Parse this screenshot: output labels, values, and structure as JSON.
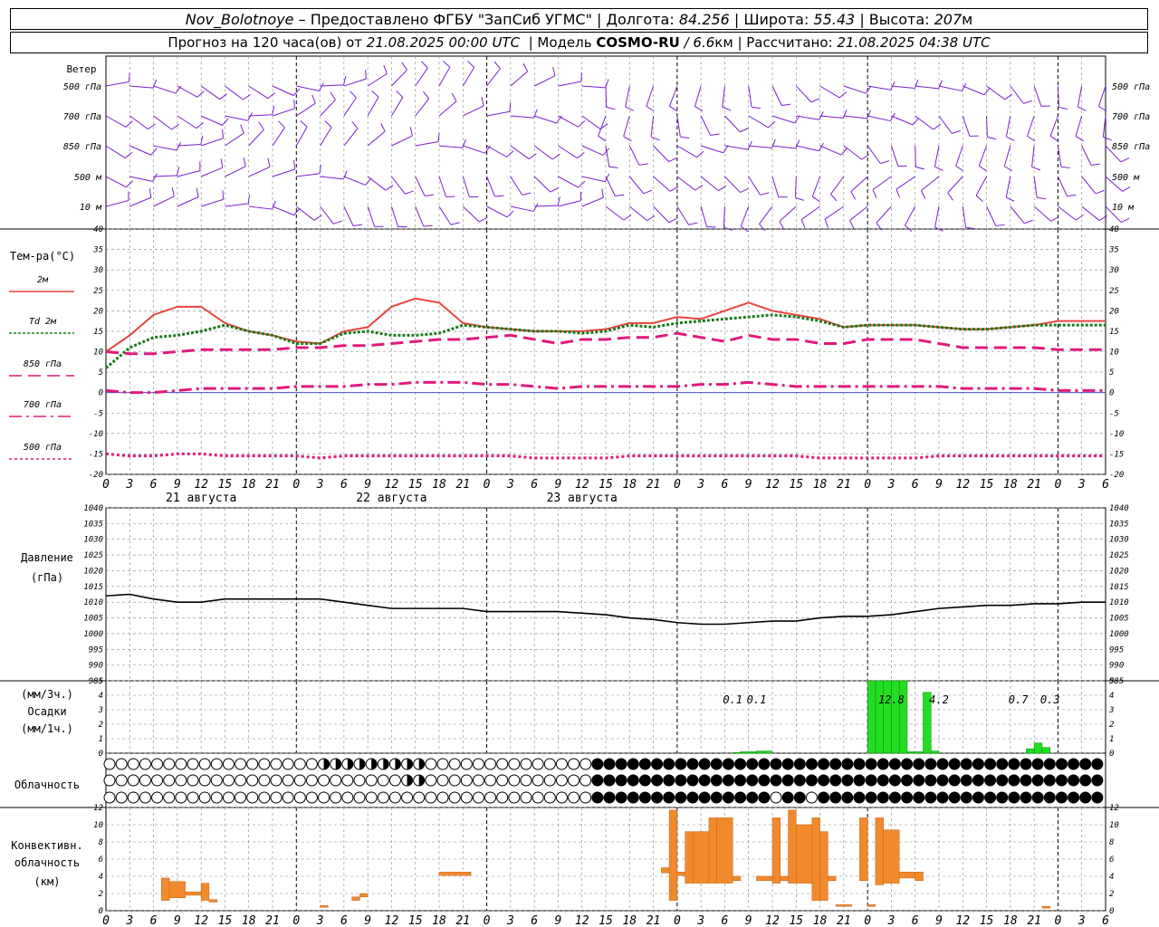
{
  "header": {
    "station": "Nov_Bolotnoye",
    "dash": " – ",
    "provider": "Предоставлено ФГБУ \"ЗапСиб УГМС\"",
    "sep": " | ",
    "lon_label": "Долгота: ",
    "lon_value": "84.256",
    "lat_label": "Широта: ",
    "lat_value": "55.43",
    "alt_label": "Высота: ",
    "alt_value": "207",
    "alt_unit": "м",
    "forecast_prefix": "Прогноз на 120 часа(ов) от ",
    "forecast_time": "21.08.2025 00:00 UTC",
    "model_label": "  | Модель ",
    "model_name": "COSMO-RU",
    "model_res": " / 6.6",
    "model_unit": "км",
    "calc_label": " | Рассчитано: ",
    "calc_time": "21.08.2025 04:38 UTC"
  },
  "colors": {
    "t2m": "#e8453c",
    "td2m": "#1a7a1a",
    "t850": "#e0197d",
    "t700": "#e0197d",
    "t500": "#e0197d",
    "wind": "#7a1fd0",
    "pressure": "#000000",
    "precip": "#22dd22",
    "conv": "#f08a2c",
    "grid": "#888888",
    "zero_line": "#3333cc"
  },
  "wind_panel": {
    "title": "Ветер",
    "levels": [
      "500 гПа",
      "700 гПа",
      "850 гПа",
      "500  м",
      "10   м"
    ],
    "right_levels": [
      "500 гПа",
      "700 гПа",
      "850 гПа",
      "500  м",
      "10   м"
    ]
  },
  "temp_panel": {
    "title": "Тем-ра(°C)",
    "legend": [
      {
        "label": "2м",
        "series": "t2m"
      },
      {
        "label": "Td  2м",
        "series": "td2m"
      },
      {
        "label": "850 гПа",
        "series": "t850"
      },
      {
        "label": "700 гПа",
        "series": "t700"
      },
      {
        "label": "500 гПа",
        "series": "t500"
      }
    ]
  },
  "pressure_panel": {
    "title": "Давление",
    "unit": "(гПа)"
  },
  "precip_panel": {
    "unit1": "(мм/3ч.)",
    "title": "Осадки",
    "unit2": "(мм/1ч.)"
  },
  "cloud_panel": {
    "title": "Облачность"
  },
  "conv_panel": {
    "title1": "Конвективн.",
    "title2": "облачность",
    "unit": "(км)"
  },
  "x_axis": {
    "hour_labels": [
      "0",
      "3",
      "6",
      "9",
      "12",
      "15",
      "18",
      "21",
      "0",
      "3",
      "6",
      "9",
      "12",
      "15",
      "18",
      "21",
      "0",
      "3",
      "6",
      "9",
      "12",
      "15",
      "18",
      "21",
      "0",
      "3",
      "6"
    ],
    "date_labels": [
      "21 августа",
      "22 августа",
      "23 августа"
    ]
  },
  "chart_data": [
    {
      "type": "line",
      "title": "Тем-ра(°C)",
      "x_hours": [
        0,
        3,
        6,
        9,
        12,
        15,
        18,
        21,
        24,
        27,
        30,
        33,
        36,
        39,
        42,
        45,
        48,
        51,
        54,
        57,
        60,
        63,
        66,
        69,
        72,
        75,
        78,
        81,
        84,
        87,
        90,
        93,
        96,
        99,
        102,
        105,
        108,
        111,
        114,
        117,
        120,
        123,
        126
      ],
      "ylim": [
        -20,
        40
      ],
      "yticks": [
        -20,
        -15,
        -10,
        -5,
        0,
        5,
        10,
        15,
        20,
        25,
        30,
        35,
        40
      ],
      "series": [
        {
          "name": "2м",
          "values": [
            10,
            14,
            19,
            21,
            21,
            17,
            15,
            14,
            12.5,
            12,
            15,
            16,
            21,
            23,
            22,
            17,
            16,
            15.5,
            15,
            15,
            15,
            15.5,
            17,
            17,
            18.5,
            18,
            20,
            22,
            20,
            19,
            18,
            16,
            16.5,
            16.5,
            16.5,
            16,
            15.5,
            15.5,
            16,
            16.5,
            17.5,
            17.5,
            17.5
          ]
        },
        {
          "name": "Td 2м",
          "values": [
            6,
            11,
            13.5,
            14,
            15,
            16.5,
            15,
            14,
            12,
            12,
            14.5,
            15,
            14,
            14,
            14.5,
            16.5,
            16,
            15.5,
            15,
            15,
            14.5,
            15,
            16.5,
            16,
            17,
            17.5,
            18,
            18.5,
            19,
            18.5,
            17.5,
            16,
            16.5,
            16.5,
            16.5,
            16,
            15.5,
            15.5,
            16,
            16.5,
            16.5,
            16.5,
            16.5
          ]
        },
        {
          "name": "850 гПа",
          "values": [
            10,
            9.5,
            9.5,
            10,
            10.5,
            10.5,
            10.5,
            10.5,
            11,
            11,
            11.5,
            11.5,
            12,
            12.5,
            13,
            13,
            13.5,
            14,
            13,
            12,
            13,
            13,
            13.5,
            13.5,
            14.5,
            13.5,
            12.5,
            14,
            13,
            13,
            12,
            12,
            13,
            13,
            13,
            12,
            11,
            11,
            11,
            11,
            10.5,
            10.5,
            10.5
          ]
        },
        {
          "name": "700 гПа",
          "values": [
            0.5,
            0,
            0,
            0.5,
            1,
            1,
            1,
            1,
            1.5,
            1.5,
            1.5,
            2,
            2,
            2.5,
            2.5,
            2.5,
            2,
            2,
            1.5,
            1,
            1.5,
            1.5,
            1.5,
            1.5,
            1.5,
            2,
            2,
            2.5,
            2,
            1.5,
            1.5,
            1.5,
            1.5,
            1.5,
            1.5,
            1.5,
            1,
            1,
            1,
            1,
            0.5,
            0.5,
            0.5
          ]
        },
        {
          "name": "500 гПа",
          "values": [
            -15,
            -15.5,
            -15.5,
            -15,
            -15,
            -15.5,
            -15.5,
            -15.5,
            -15.5,
            -16,
            -15.5,
            -15.5,
            -15.5,
            -15.5,
            -15.5,
            -15.5,
            -15.5,
            -15.5,
            -16,
            -16,
            -16,
            -16,
            -15.5,
            -15.5,
            -15.5,
            -15.5,
            -15.5,
            -15.5,
            -15.5,
            -15.5,
            -16,
            -16,
            -16,
            -16,
            -16,
            -15.5,
            -15.5,
            -15.5,
            -15.5,
            -15.5,
            -15.5,
            -15.5,
            -15.5
          ]
        }
      ]
    },
    {
      "type": "line",
      "title": "Давление (гПа)",
      "x_hours": [
        0,
        3,
        6,
        9,
        12,
        15,
        18,
        21,
        24,
        27,
        30,
        33,
        36,
        39,
        42,
        45,
        48,
        51,
        54,
        57,
        60,
        63,
        66,
        69,
        72,
        75,
        78,
        81,
        84,
        87,
        90,
        93,
        96,
        99,
        102,
        105,
        108,
        111,
        114,
        117,
        120,
        123,
        126
      ],
      "ylim": [
        985,
        1040
      ],
      "yticks": [
        985,
        990,
        995,
        1000,
        1005,
        1010,
        1015,
        1020,
        1025,
        1030,
        1035,
        1040
      ],
      "series": [
        {
          "name": "Давление",
          "values": [
            1012,
            1012.5,
            1011,
            1010,
            1010,
            1011,
            1011,
            1011,
            1011,
            1011,
            1010,
            1009,
            1008,
            1008,
            1008,
            1008,
            1007,
            1007,
            1007,
            1007,
            1006.5,
            1006,
            1005,
            1004.5,
            1003.5,
            1003,
            1003,
            1003.5,
            1004,
            1004,
            1005,
            1005.5,
            1005.5,
            1006,
            1007,
            1008,
            1008.5,
            1009,
            1009,
            1009.5,
            1009.5,
            1010,
            1010
          ]
        }
      ]
    },
    {
      "type": "bar",
      "title": "Осадки",
      "ylim": [
        0,
        5
      ],
      "yticks": [
        0,
        1,
        2,
        3,
        4,
        5
      ],
      "bars": [
        {
          "hour": 79,
          "value": 0.05
        },
        {
          "hour": 80,
          "value": 0.1
        },
        {
          "hour": 81,
          "value": 0.1
        },
        {
          "hour": 82,
          "value": 0.15
        },
        {
          "hour": 83,
          "value": 0.15
        },
        {
          "hour": 96,
          "value": 6.0
        },
        {
          "hour": 97,
          "value": 6.0
        },
        {
          "hour": 98,
          "value": 6.0
        },
        {
          "hour": 99,
          "value": 6.0
        },
        {
          "hour": 100,
          "value": 6.0
        },
        {
          "hour": 101,
          "value": 0.1
        },
        {
          "hour": 102,
          "value": 0.1
        },
        {
          "hour": 103,
          "value": 4.2
        },
        {
          "hour": 104,
          "value": 0.15
        },
        {
          "hour": 116,
          "value": 0.3
        },
        {
          "hour": 117,
          "value": 0.7
        },
        {
          "hour": 118,
          "value": 0.4
        }
      ],
      "labels": [
        {
          "hour": 79,
          "text": "0.1"
        },
        {
          "hour": 82,
          "text": "0.1"
        },
        {
          "hour": 99,
          "text": "12.8"
        },
        {
          "hour": 105,
          "text": "4.2"
        },
        {
          "hour": 115,
          "text": "0.7"
        },
        {
          "hour": 119,
          "text": "0.3"
        }
      ]
    },
    {
      "type": "bar",
      "title": "Конвективн. облачность (км)",
      "ylim": [
        0,
        12
      ],
      "yticks": [
        0,
        2,
        4,
        6,
        8,
        10,
        12
      ],
      "bars": [
        {
          "from": 7,
          "to": 8,
          "bottom": 1.2,
          "top": 3.8
        },
        {
          "from": 8,
          "to": 10,
          "bottom": 1.5,
          "top": 3.4
        },
        {
          "from": 10,
          "to": 12,
          "bottom": 1.8,
          "top": 2.2
        },
        {
          "from": 12,
          "to": 13,
          "bottom": 1.2,
          "top": 3.2
        },
        {
          "from": 13,
          "to": 14,
          "bottom": 1.0,
          "top": 1.3
        },
        {
          "from": 27,
          "to": 28,
          "bottom": 0.4,
          "top": 0.6
        },
        {
          "from": 31,
          "to": 32,
          "bottom": 1.2,
          "top": 1.6
        },
        {
          "from": 32,
          "to": 33,
          "bottom": 1.6,
          "top": 2.0
        },
        {
          "from": 42,
          "to": 46,
          "bottom": 4.1,
          "top": 4.5
        },
        {
          "from": 70,
          "to": 71,
          "bottom": 4.4,
          "top": 5.0
        },
        {
          "from": 71,
          "to": 72,
          "bottom": 1.2,
          "top": 11.7
        },
        {
          "from": 72,
          "to": 73,
          "bottom": 4.1,
          "top": 4.5
        },
        {
          "from": 73,
          "to": 74,
          "bottom": 3.2,
          "top": 9.2
        },
        {
          "from": 74,
          "to": 76,
          "bottom": 3.2,
          "top": 9.2
        },
        {
          "from": 76,
          "to": 77,
          "bottom": 3.2,
          "top": 10.8
        },
        {
          "from": 77,
          "to": 79,
          "bottom": 3.2,
          "top": 10.8
        },
        {
          "from": 79,
          "to": 80,
          "bottom": 3.5,
          "top": 4.0
        },
        {
          "from": 82,
          "to": 84,
          "bottom": 3.5,
          "top": 4.0
        },
        {
          "from": 84,
          "to": 85,
          "bottom": 3.2,
          "top": 10.8
        },
        {
          "from": 85,
          "to": 86,
          "bottom": 3.5,
          "top": 4.0
        },
        {
          "from": 86,
          "to": 87,
          "bottom": 3.2,
          "top": 11.7
        },
        {
          "from": 87,
          "to": 89,
          "bottom": 3.2,
          "top": 10.0
        },
        {
          "from": 89,
          "to": 90,
          "bottom": 1.2,
          "top": 10.8
        },
        {
          "from": 90,
          "to": 91,
          "bottom": 1.2,
          "top": 9.2
        },
        {
          "from": 91,
          "to": 92,
          "bottom": 3.5,
          "top": 4.0
        },
        {
          "from": 92,
          "to": 94,
          "bottom": 0.5,
          "top": 0.7
        },
        {
          "from": 95,
          "to": 96,
          "bottom": 3.5,
          "top": 10.8
        },
        {
          "from": 96,
          "to": 97,
          "bottom": 0.5,
          "top": 0.7
        },
        {
          "from": 97,
          "to": 98,
          "bottom": 3.0,
          "top": 10.8
        },
        {
          "from": 98,
          "to": 100,
          "bottom": 3.2,
          "top": 9.4
        },
        {
          "from": 100,
          "to": 102,
          "bottom": 3.8,
          "top": 4.5
        },
        {
          "from": 102,
          "to": 103,
          "bottom": 3.5,
          "top": 4.5
        },
        {
          "from": 118,
          "to": 119,
          "bottom": 0.3,
          "top": 0.5
        }
      ]
    }
  ]
}
